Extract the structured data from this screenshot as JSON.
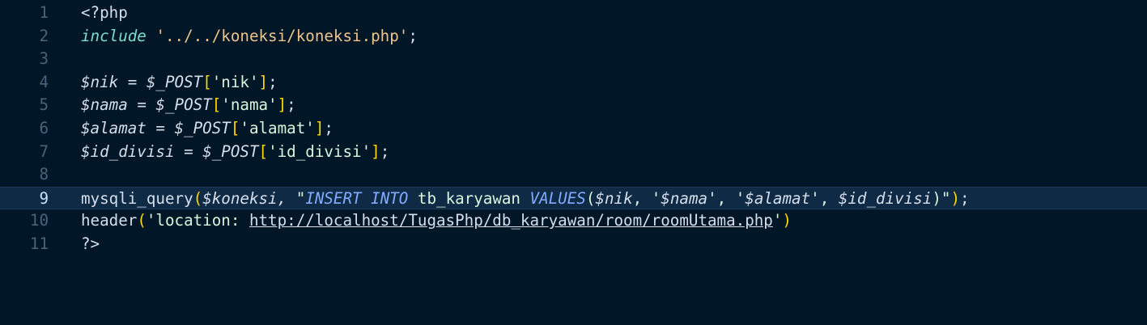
{
  "editor": {
    "lines": [
      {
        "number": "1",
        "parts": [
          {
            "t": "<?php",
            "c": "tag"
          }
        ]
      },
      {
        "number": "2",
        "parts": [
          {
            "t": "include",
            "c": "include"
          },
          {
            "t": " ",
            "c": "plain"
          },
          {
            "t": "'../../koneksi/koneksi.php'",
            "c": "str"
          },
          {
            "t": ";",
            "c": "plain"
          }
        ]
      },
      {
        "number": "3",
        "parts": []
      },
      {
        "number": "4",
        "parts": [
          {
            "t": "$nik",
            "c": "var"
          },
          {
            "t": " = ",
            "c": "var"
          },
          {
            "t": "$_POST",
            "c": "var"
          },
          {
            "t": "[",
            "c": "brk"
          },
          {
            "t": "'nik'",
            "c": "strbody"
          },
          {
            "t": "]",
            "c": "brk"
          },
          {
            "t": ";",
            "c": "plain"
          }
        ]
      },
      {
        "number": "5",
        "parts": [
          {
            "t": "$nama",
            "c": "var"
          },
          {
            "t": " = ",
            "c": "var"
          },
          {
            "t": "$_POST",
            "c": "var"
          },
          {
            "t": "[",
            "c": "brk"
          },
          {
            "t": "'nama'",
            "c": "strbody"
          },
          {
            "t": "]",
            "c": "brk"
          },
          {
            "t": ";",
            "c": "plain"
          }
        ]
      },
      {
        "number": "6",
        "parts": [
          {
            "t": "$alamat",
            "c": "var"
          },
          {
            "t": " = ",
            "c": "var"
          },
          {
            "t": "$_POST",
            "c": "var"
          },
          {
            "t": "[",
            "c": "brk"
          },
          {
            "t": "'alamat'",
            "c": "strbody"
          },
          {
            "t": "]",
            "c": "brk"
          },
          {
            "t": ";",
            "c": "plain"
          }
        ]
      },
      {
        "number": "7",
        "parts": [
          {
            "t": "$id_divisi",
            "c": "var"
          },
          {
            "t": " = ",
            "c": "var"
          },
          {
            "t": "$_POST",
            "c": "var"
          },
          {
            "t": "[",
            "c": "brk"
          },
          {
            "t": "'id_divisi'",
            "c": "strbody"
          },
          {
            "t": "]",
            "c": "brk"
          },
          {
            "t": ";",
            "c": "plain"
          }
        ]
      },
      {
        "number": "8",
        "parts": []
      },
      {
        "number": "9",
        "current": true,
        "parts": [
          {
            "t": "mysqli_query",
            "c": "fn"
          },
          {
            "t": "(",
            "c": "paren"
          },
          {
            "t": "$koneksi",
            "c": "var"
          },
          {
            "t": ", ",
            "c": "var"
          },
          {
            "t": "\"",
            "c": "strbody"
          },
          {
            "t": "INSERT INTO",
            "c": "sql"
          },
          {
            "t": " tb_karyawan ",
            "c": "strbody"
          },
          {
            "t": "VALUES",
            "c": "sql"
          },
          {
            "t": "(",
            "c": "strbody"
          },
          {
            "t": "$nik",
            "c": "var"
          },
          {
            "t": ", '",
            "c": "strbody"
          },
          {
            "t": "$nama",
            "c": "var"
          },
          {
            "t": "', '",
            "c": "strbody"
          },
          {
            "t": "$alamat",
            "c": "var"
          },
          {
            "t": "', ",
            "c": "strbody"
          },
          {
            "t": "$id_divisi",
            "c": "var"
          },
          {
            "t": ")\"",
            "c": "strbody"
          },
          {
            "t": ")",
            "c": "paren"
          },
          {
            "t": ";",
            "c": "plain"
          }
        ]
      },
      {
        "number": "10",
        "parts": [
          {
            "t": "header",
            "c": "fn"
          },
          {
            "t": "(",
            "c": "paren"
          },
          {
            "t": "'location: ",
            "c": "strbody"
          },
          {
            "t": "http://localhost/TugasPhp/db_karyawan/room/roomUtama.php",
            "c": "url"
          },
          {
            "t": "'",
            "c": "strbody"
          },
          {
            "t": ")",
            "c": "paren"
          }
        ]
      },
      {
        "number": "11",
        "parts": [
          {
            "t": "?>",
            "c": "tag"
          }
        ]
      }
    ]
  }
}
